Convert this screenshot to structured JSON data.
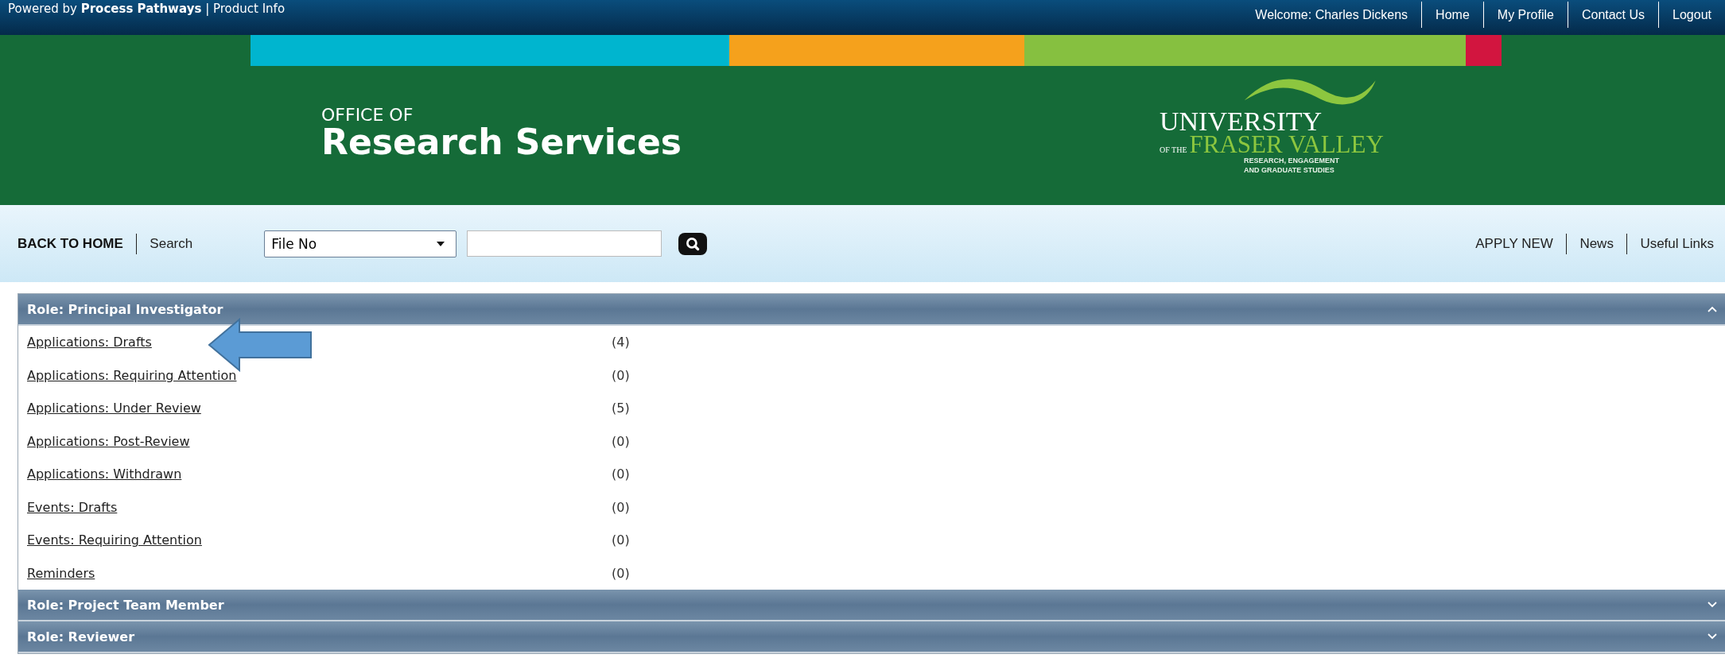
{
  "top_bar": {
    "powered_by": "Powered by **Process Pathways** | Product Info",
    "welcome": "Welcome: Charles Dickens",
    "links": [
      "Home",
      "My Profile",
      "Contact Us",
      "Logout"
    ]
  },
  "banner": {
    "office_of": "OFFICE OF",
    "title": "Research Services",
    "logo": {
      "line_1": "UNIVERSITY",
      "of_the": "OF THE",
      "line_2": "FRASER VALLEY",
      "subtitle_1": "RESEARCH, ENGAGEMENT",
      "subtitle_2": "AND GRADUATE STUDIES"
    }
  },
  "nav": {
    "back_home": "BACK TO HOME",
    "search_label": "Search",
    "search_by": "File No",
    "right_links": [
      "APPLY NEW",
      "News",
      "Useful Links"
    ]
  },
  "sections": [
    {
      "title": "Role: Principal Investigator",
      "expanded": true,
      "items": [
        {
          "label": "Applications: Drafts",
          "count": "(4)",
          "highlighted": true
        },
        {
          "label": "Applications: Requiring Attention",
          "count": "(0)",
          "highlighted": false
        },
        {
          "label": "Applications: Under Review",
          "count": "(5)",
          "highlighted": false
        },
        {
          "label": "Applications: Post-Review",
          "count": "(0)",
          "highlighted": false
        },
        {
          "label": "Applications: Withdrawn",
          "count": "(0)",
          "highlighted": false
        },
        {
          "label": "Events: Drafts",
          "count": "(0)",
          "highlighted": false
        },
        {
          "label": "Events: Requiring Attention",
          "count": "(0)",
          "highlighted": false
        },
        {
          "label": "Reminders",
          "count": "(0)",
          "highlighted": false
        }
      ]
    },
    {
      "title": "Role: Project Team Member",
      "expanded": false
    },
    {
      "title": "Role: Reviewer",
      "expanded": false
    }
  ]
}
